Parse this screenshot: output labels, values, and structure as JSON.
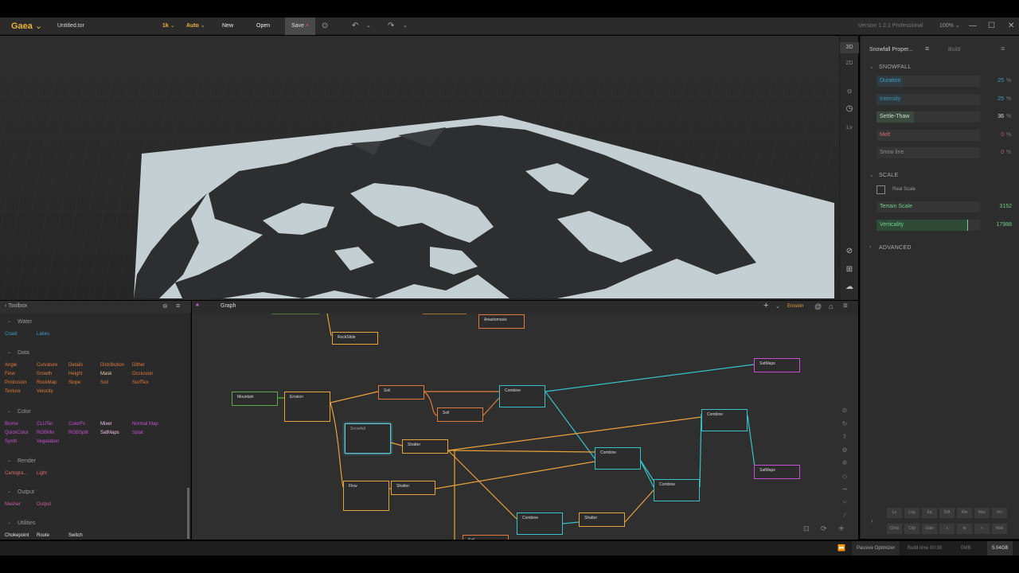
{
  "titlebar": {
    "app_name": "Gaea",
    "file_name": "Untitled.tor",
    "resolution": "1k",
    "mode": "Auto",
    "new_label": "New",
    "open_label": "Open",
    "save_label": "Save",
    "version": "Version 1.2.1 Professional",
    "zoom": "100%"
  },
  "viewport_tools": {
    "view3d": "3D",
    "view2d": "2D",
    "lv": "Lv"
  },
  "properties": {
    "tab_title": "Snowfall Proper...",
    "build_tab": "Build",
    "snowfall_section": "SNOWFALL",
    "scale_section": "SCALE",
    "advanced_section": "ADVANCED",
    "real_scale_label": "Real Scale",
    "sliders": [
      {
        "label": "Duration",
        "value": "25",
        "unit": "%",
        "fill": 0.25
      },
      {
        "label": "Intensity",
        "value": "25",
        "unit": "%",
        "fill": 0.25
      },
      {
        "label": "Settle-Thaw",
        "value": "36",
        "unit": "%",
        "fill": 0.36
      },
      {
        "label": "Melt",
        "value": "0",
        "unit": "%",
        "fill": 0
      },
      {
        "label": "Snow line",
        "value": "0",
        "unit": "%",
        "fill": 0
      }
    ],
    "scale_sliders": [
      {
        "label": "Terrain Scale",
        "value": "3152",
        "fill": 0.0
      },
      {
        "label": "Verticality",
        "value": "17988",
        "fill": 0.88
      }
    ]
  },
  "toolbox": {
    "title": "Toolbox",
    "sections": [
      {
        "name": "Water",
        "items": [
          "Coast",
          "Lakes"
        ]
      },
      {
        "name": "Data",
        "items": [
          "Angle",
          "Curvature",
          "Details",
          "Distribution",
          "Dither",
          "Flow",
          "Growth",
          "Height",
          "Mask",
          "Occlusion",
          "Protrusion",
          "RockMap",
          "Slope",
          "Soil",
          "SurfTex",
          "Texture",
          "Velocity"
        ]
      },
      {
        "name": "Color",
        "items": [
          "Biome",
          "CLUTer",
          "ColorFx",
          "Mixer",
          "Normal Map",
          "QuickColor",
          "RGBMix",
          "RGBSplit",
          "SatMaps",
          "Splat",
          "Synth",
          "Vegetation"
        ]
      },
      {
        "name": "Render",
        "items": [
          "Cartogra...",
          "Light"
        ]
      },
      {
        "name": "Output",
        "items": [
          "Mesher",
          "Output"
        ]
      },
      {
        "name": "Utilities",
        "items": [
          "Chokepoint",
          "Route",
          "Switch"
        ]
      }
    ]
  },
  "graph": {
    "tab": "Graph",
    "filter": "Erosion",
    "nodes": [
      "RockSlide",
      "Anastomosis",
      "SatMaps",
      "Mountain",
      "Erosion",
      "Soil",
      "Combine",
      "Soil",
      "Snowfall",
      "Shatter",
      "Combine",
      "Combine",
      "Flow",
      "Shatter",
      "Combine",
      "SatMaps",
      "Combine",
      "Shatter",
      "Soil"
    ]
  },
  "bottom_buttons": [
    "Lv",
    "Log",
    "Eq",
    "Diff",
    "Min",
    "Max",
    "Inv",
    "Clmp",
    "Clip",
    "Gain",
    "",
    "",
    "",
    "Msk"
  ],
  "status": {
    "optimizer": "Passive Optimizer",
    "build_time": "Build time 00:38",
    "memory": "0MB",
    "gb": "5.04GB"
  },
  "colors": {
    "accent": "#e8b23a",
    "data": "#e07a3a",
    "color": "#c84fd6",
    "water": "#3fa0c8",
    "erosion": "#e8a23a",
    "combine": "#36c2c8",
    "primitive": "#5aaa4a"
  }
}
